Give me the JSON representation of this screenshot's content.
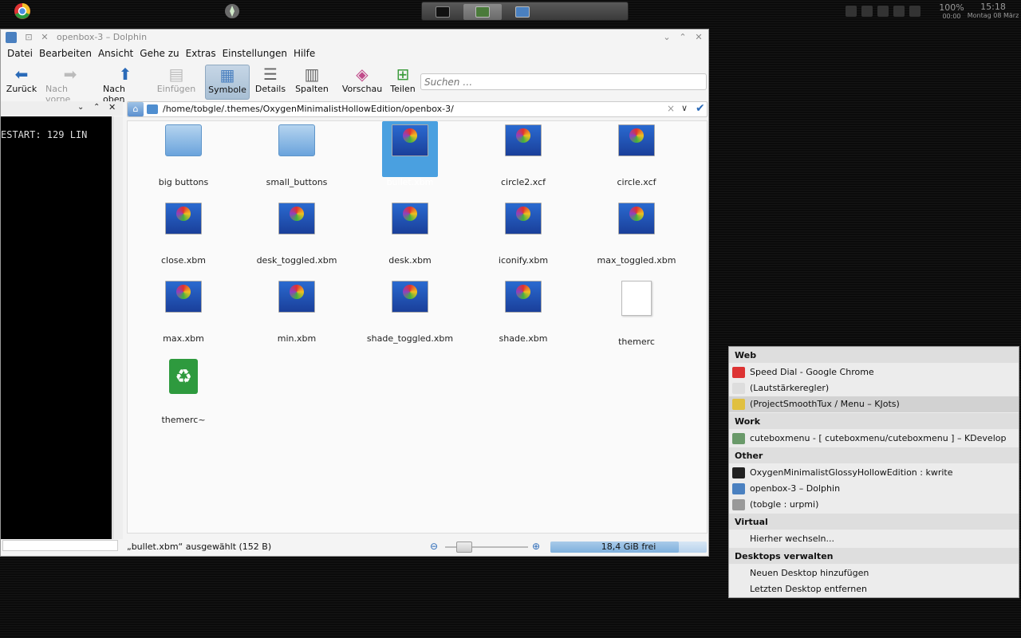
{
  "panel": {
    "taskbar": [
      {
        "name": "terminal-task",
        "color": "#111111"
      },
      {
        "name": "kwrite-task",
        "color": "#4a7a3a"
      },
      {
        "name": "dolphin-task",
        "color": "#4a80c0"
      }
    ],
    "battery_pct": "100%",
    "battery_time": "00:00",
    "clock_time": "15:18",
    "clock_date": "Montag 08 März"
  },
  "window": {
    "title": "openbox-3 – Dolphin"
  },
  "menubar": [
    {
      "label": "Datei"
    },
    {
      "label": "Bearbeiten"
    },
    {
      "label": "Ansicht"
    },
    {
      "label": "Gehe zu"
    },
    {
      "label": "Extras"
    },
    {
      "label": "Einstellungen"
    },
    {
      "label": "Hilfe"
    }
  ],
  "toolbar": {
    "back": "Zurück",
    "forward": "Nach vorne",
    "up": "Nach oben",
    "paste": "Einfügen",
    "icons": "Symbole",
    "details": "Details",
    "columns": "Spalten",
    "preview": "Vorschau",
    "split": "Teilen",
    "search_placeholder": "Suchen …"
  },
  "terminal": {
    "text": "ESTART:  129  LIN"
  },
  "location": {
    "path": "/home/tobgle/.themes/OxygenMinimalistHollowEdition/openbox-3/"
  },
  "files": [
    {
      "name": "big buttons",
      "type": "folder"
    },
    {
      "name": "small_buttons",
      "type": "folder"
    },
    {
      "name": "bullet.xbm",
      "type": "image",
      "selected": true
    },
    {
      "name": "circle2.xcf",
      "type": "image"
    },
    {
      "name": "circle.xcf",
      "type": "image"
    },
    {
      "name": "close.xbm",
      "type": "image"
    },
    {
      "name": "desk_toggled.xbm",
      "type": "image"
    },
    {
      "name": "desk.xbm",
      "type": "image"
    },
    {
      "name": "iconify.xbm",
      "type": "image"
    },
    {
      "name": "max_toggled.xbm",
      "type": "image"
    },
    {
      "name": "max.xbm",
      "type": "image"
    },
    {
      "name": "min.xbm",
      "type": "image"
    },
    {
      "name": "shade_toggled.xbm",
      "type": "image"
    },
    {
      "name": "shade.xbm",
      "type": "image"
    },
    {
      "name": "themerc",
      "type": "document"
    },
    {
      "name": "themerc~",
      "type": "trash"
    }
  ],
  "status": {
    "text": "„bullet.xbm“ ausgewählt (152 B)",
    "free_space": "18,4 GiB frei",
    "used_fraction": 0.82
  },
  "menu": {
    "sections": [
      {
        "title": "Web",
        "items": [
          {
            "label": "Speed Dial - Google Chrome",
            "icon": "chrome-icon"
          },
          {
            "label": "(Lautstärkeregler)",
            "icon": "volume-icon"
          },
          {
            "label": "(ProjectSmoothTux / Menu – KJots)",
            "icon": "kjots-icon",
            "highlighted": true
          }
        ]
      },
      {
        "title": "Work",
        "items": [
          {
            "label": "cuteboxmenu - [ cuteboxmenu/cuteboxmenu ] – KDevelop",
            "icon": "kdevelop-icon"
          }
        ]
      },
      {
        "title": "Other",
        "items": [
          {
            "label": "OxygenMinimalistGlossyHollowEdition : kwrite",
            "icon": "terminal-icon"
          },
          {
            "label": "openbox-3 – Dolphin",
            "icon": "dolphin-icon"
          },
          {
            "label": "(tobgle : urpmi)",
            "icon": "konsole-icon"
          }
        ]
      },
      {
        "title": "Virtual",
        "items": [
          {
            "label": "Hierher wechseln...",
            "icon": ""
          }
        ]
      },
      {
        "title": "Desktops verwalten",
        "items": [
          {
            "label": "Neuen Desktop hinzufügen",
            "icon": ""
          },
          {
            "label": "Letzten Desktop entfernen",
            "icon": ""
          }
        ]
      }
    ]
  }
}
